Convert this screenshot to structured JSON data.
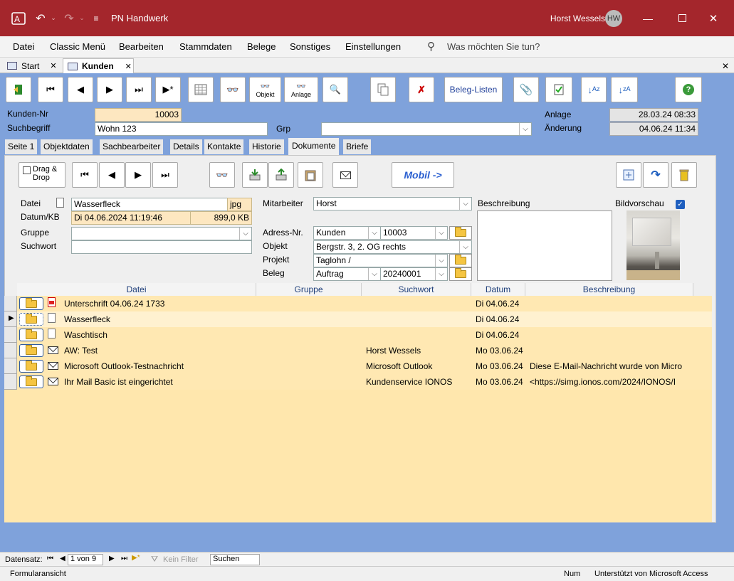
{
  "app": {
    "title": "PN Handwerk",
    "user_name": "Horst Wessels",
    "user_initials": "HW"
  },
  "menu": [
    "Datei",
    "Classic Menü",
    "Bearbeiten",
    "Stammdaten",
    "Belege",
    "Sonstiges",
    "Einstellungen"
  ],
  "search_prompt": "Was möchten Sie tun?",
  "doc_tabs": [
    {
      "label": "Start"
    },
    {
      "label": "Kunden"
    }
  ],
  "toolbar": {
    "objekt_label": "Objekt",
    "anlage_label": "Anlage",
    "beleg_listen_label": "Beleg-Listen"
  },
  "header": {
    "kunden_nr_label": "Kunden-Nr",
    "kunden_nr": "10003",
    "suchbegriff_label": "Suchbegriff",
    "suchbegriff": "Wohn 123",
    "grp_label": "Grp",
    "grp": "",
    "anlage_label": "Anlage",
    "anlage": "28.03.24 08:33",
    "aenderung_label": "Änderung",
    "aenderung": "04.06.24 11:34"
  },
  "form_tabs": [
    "Seite 1",
    "Objektdaten",
    "Sachbearbeiter",
    "Details",
    "Kontakte",
    "Historie",
    "Dokumente",
    "Briefe"
  ],
  "subtoolbar": {
    "drag_drop_label": "Drag & Drop",
    "mobil_label": "Mobil ->"
  },
  "doc_detail": {
    "datei_label": "Datei",
    "datei": "Wasserfleck",
    "ext": "jpg",
    "datum_label": "Datum/KB",
    "datum": "Di 04.06.2024 11:19:46",
    "size": "899,0 KB",
    "gruppe_label": "Gruppe",
    "gruppe": "",
    "suchwort_label": "Suchwort",
    "suchwort": "",
    "mitarbeiter_label": "Mitarbeiter",
    "mitarbeiter": "Horst",
    "adress_label": "Adress-Nr.",
    "adress_type": "Kunden",
    "adress_nr": "10003",
    "objekt_label": "Objekt",
    "objekt": "Bergstr. 3, 2. OG rechts",
    "projekt_label": "Projekt",
    "projekt": "Taglohn /",
    "beleg_label": "Beleg",
    "beleg_type": "Auftrag",
    "beleg_nr": "20240001",
    "beschreibung_label": "Beschreibung",
    "bildvorschau_label": "Bildvorschau"
  },
  "grid": {
    "columns": [
      "Datei",
      "Gruppe",
      "Suchwort",
      "Datum",
      "Beschreibung"
    ],
    "rows": [
      {
        "icon": "pdf-icon",
        "datei": "Unterschrift 04.06.24 1733",
        "suchwort": "",
        "datum": "Di 04.06.24",
        "beschreibung": ""
      },
      {
        "icon": "document-icon",
        "datei": "Wasserfleck",
        "suchwort": "",
        "datum": "Di 04.06.24",
        "beschreibung": ""
      },
      {
        "icon": "document-icon",
        "datei": "Waschtisch",
        "suchwort": "",
        "datum": "Di 04.06.24",
        "beschreibung": ""
      },
      {
        "icon": "mail-icon",
        "datei": "AW: Test",
        "suchwort": "Horst Wessels",
        "datum": "Mo 03.06.24",
        "beschreibung": ""
      },
      {
        "icon": "mail-icon",
        "datei": "Microsoft Outlook-Testnachricht",
        "suchwort": "Microsoft Outlook",
        "datum": "Mo 03.06.24",
        "beschreibung": "Diese E-Mail-Nachricht wurde von Micro"
      },
      {
        "icon": "mail-icon",
        "datei": "Ihr Mail Basic ist eingerichtet",
        "suchwort": "Kundenservice IONOS",
        "datum": "Mo 03.06.24",
        "beschreibung": "<https://simg.ionos.com/2024/IONOS/I"
      }
    ]
  },
  "navigation": {
    "label": "Datensatz:",
    "position": "1 von 9",
    "filter": "Kein Filter",
    "search": "Suchen"
  },
  "status": {
    "left": "Formularansicht",
    "num": "Num",
    "right": "Unterstützt von Microsoft Access"
  }
}
